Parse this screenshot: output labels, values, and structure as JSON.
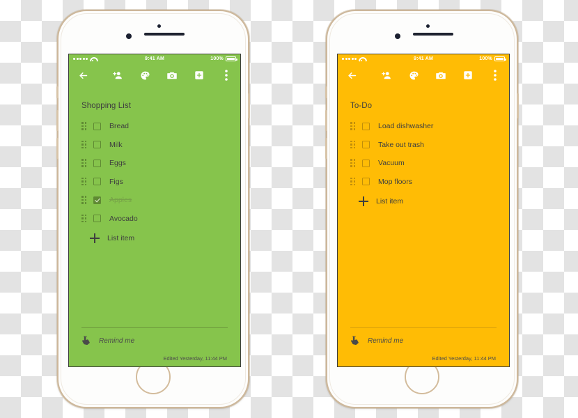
{
  "phones": [
    {
      "id": "phone-left",
      "theme": "green",
      "accent": "#86c44c",
      "status_bar": {
        "time": "9:41 AM",
        "battery_percent": "100%"
      },
      "toolbar": {
        "back_label": "Back",
        "icons": [
          "add-person-icon",
          "palette-icon",
          "camera-icon",
          "add-box-icon",
          "overflow-menu-icon"
        ]
      },
      "note": {
        "title": "Shopping List",
        "items": [
          {
            "label": "Bread",
            "checked": false
          },
          {
            "label": "Milk",
            "checked": false
          },
          {
            "label": "Eggs",
            "checked": false
          },
          {
            "label": "Figs",
            "checked": false
          },
          {
            "label": "Apples",
            "checked": true
          },
          {
            "label": "Avocado",
            "checked": false
          }
        ],
        "add_item_label": "List item",
        "remind_label": "Remind me",
        "edited_label": "Edited Yesterday, 11:44 PM"
      }
    },
    {
      "id": "phone-right",
      "theme": "orange",
      "accent": "#ffbc05",
      "status_bar": {
        "time": "9:41 AM",
        "battery_percent": "100%"
      },
      "toolbar": {
        "back_label": "Back",
        "icons": [
          "add-person-icon",
          "palette-icon",
          "camera-icon",
          "add-box-icon",
          "overflow-menu-icon"
        ]
      },
      "note": {
        "title": "To-Do",
        "items": [
          {
            "label": "Load dishwasher",
            "checked": false
          },
          {
            "label": "Take out trash",
            "checked": false
          },
          {
            "label": "Vacuum",
            "checked": false
          },
          {
            "label": "Mop floors",
            "checked": false
          }
        ],
        "add_item_label": "List item",
        "remind_label": "Remind me",
        "edited_label": "Edited Yesterday, 11:44 PM"
      }
    }
  ]
}
